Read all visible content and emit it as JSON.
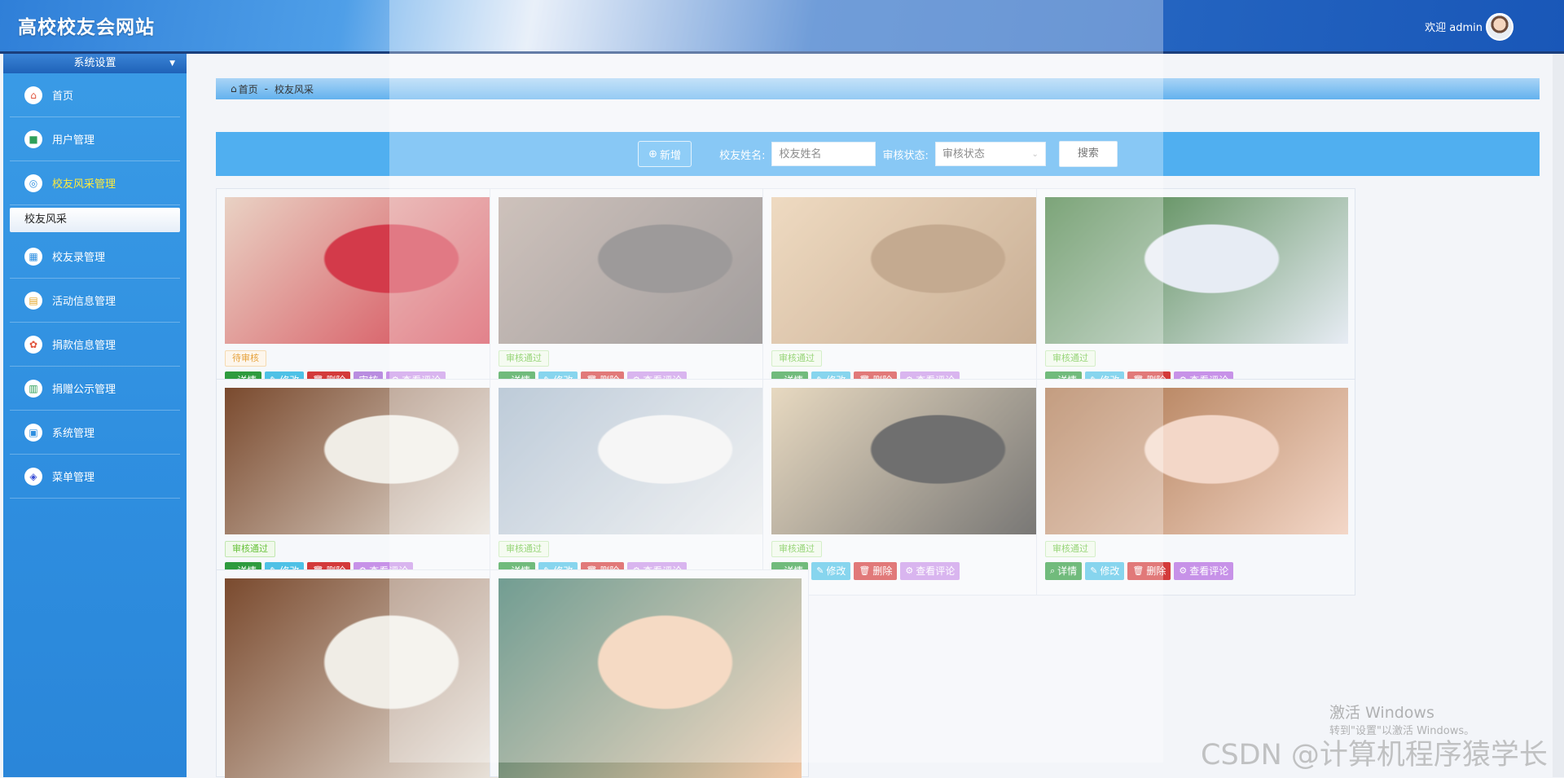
{
  "header": {
    "site_title": "高校校友会网站",
    "welcome": "欢迎 admin"
  },
  "sidebar": {
    "section_title": "系统设置",
    "items": [
      {
        "label": "首页",
        "icon": "home-icon"
      },
      {
        "label": "用户管理",
        "icon": "user-icon"
      },
      {
        "label": "校友风采管理",
        "icon": "globe-icon",
        "active": true
      },
      {
        "label": "校友录管理",
        "icon": "grid-icon"
      },
      {
        "label": "活动信息管理",
        "icon": "calendar-icon"
      },
      {
        "label": "捐款信息管理",
        "icon": "flower-icon"
      },
      {
        "label": "捐赠公示管理",
        "icon": "chart-icon"
      },
      {
        "label": "系统管理",
        "icon": "window-icon"
      },
      {
        "label": "菜单管理",
        "icon": "menu-icon"
      }
    ],
    "submenu": "校友风采"
  },
  "breadcrumb": {
    "home": "首页",
    "separator": "-",
    "current": "校友风采"
  },
  "search": {
    "new_button": "新增",
    "name_label": "校友姓名:",
    "name_placeholder": "校友姓名",
    "status_label": "审核状态:",
    "status_value": "审核状态",
    "search_button": "搜索"
  },
  "actions": {
    "detail": "详情",
    "edit": "修改",
    "delete": "删除",
    "audit": "审核",
    "comments": "查看评论"
  },
  "cards": [
    {
      "status": "待审核",
      "state": "pending",
      "tone": [
        "#e9d2c4",
        "#d33a4a"
      ]
    },
    {
      "status": "审核通过",
      "state": "passed",
      "tone": [
        "#b7a59c",
        "#6f6a6a"
      ]
    },
    {
      "status": "审核通过",
      "state": "passed",
      "tone": [
        "#e7c9a4",
        "#a9825c"
      ]
    },
    {
      "status": "审核通过",
      "state": "passed",
      "tone": [
        "#3f7a3a",
        "#e7ecf4"
      ]
    },
    {
      "status": "审核通过",
      "state": "passed",
      "tone": [
        "#7a4a2e",
        "#f0ede6"
      ]
    },
    {
      "status": "审核通过",
      "state": "passed",
      "tone": [
        "#9fb3c7",
        "#f2f2f2"
      ]
    },
    {
      "status": "审核通过",
      "state": "passed",
      "tone": [
        "#dcc7a3",
        "#2b2b2b"
      ]
    },
    {
      "status": "审核通过",
      "state": "passed",
      "tone": [
        "#a86f45",
        "#f3d7c8"
      ]
    },
    {
      "status": "",
      "state": "",
      "tone": [
        "#7a4a2e",
        "#f0ede6"
      ]
    },
    {
      "status": "",
      "state": "",
      "tone": [
        "#2f6f5f",
        "#f1c9a8"
      ]
    }
  ],
  "watermarks": {
    "windows_line1": "激活 Windows",
    "windows_line2": "转到\"设置\"以激活 Windows。",
    "csdn": "CSDN @计算机程序猿学长"
  }
}
